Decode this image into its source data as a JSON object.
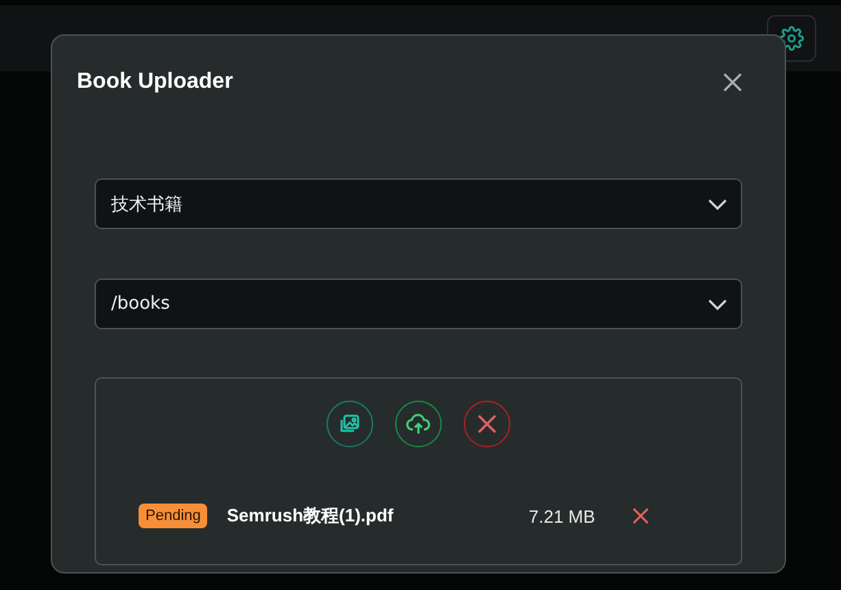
{
  "dialog": {
    "title": "Book Uploader",
    "category_select": {
      "value": "技术书籍"
    },
    "path_select": {
      "value": "/books"
    },
    "files": [
      {
        "status": "Pending",
        "color": "#f78f37",
        "name": "Semrush教程(1).pdf",
        "size": "7.21 MB"
      }
    ]
  }
}
